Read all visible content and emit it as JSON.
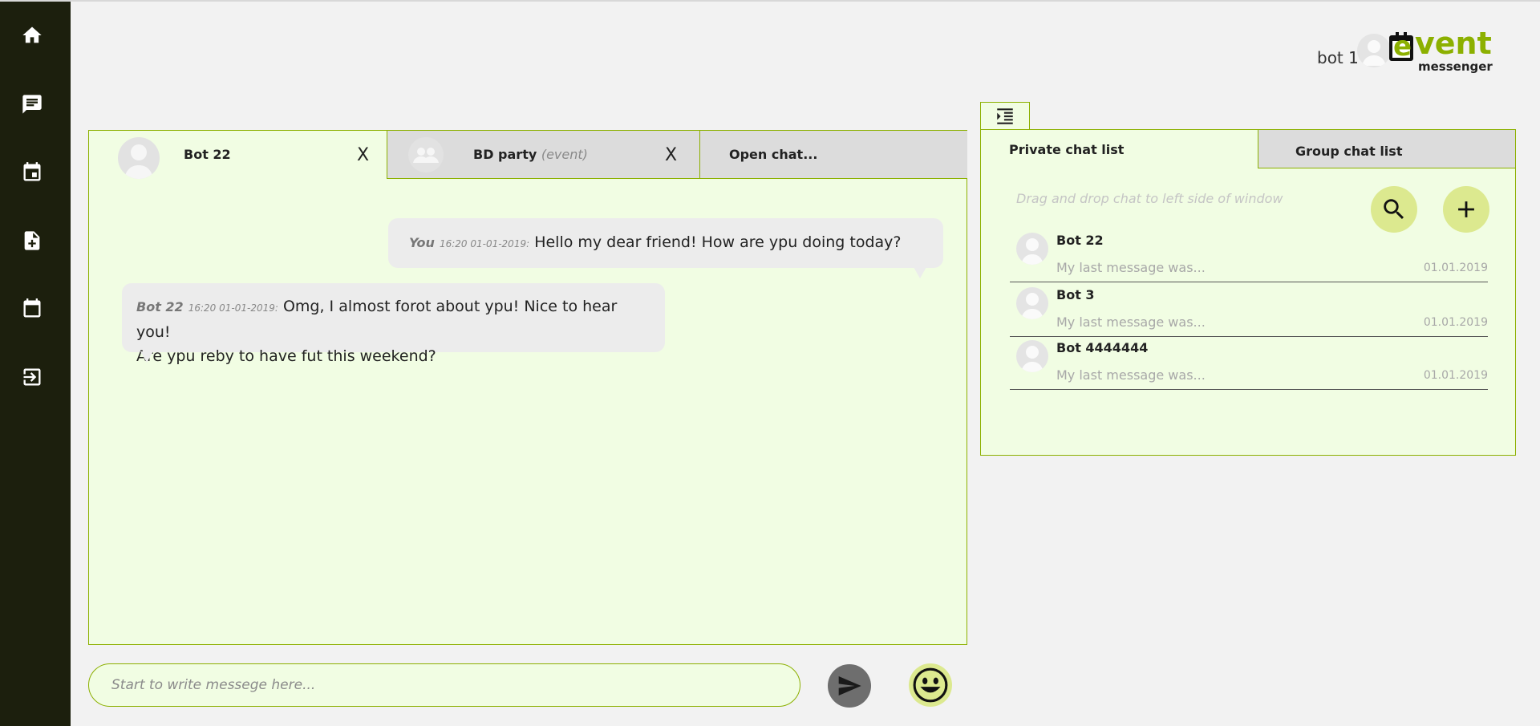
{
  "sidebar": {
    "items": [
      {
        "icon": "home-icon"
      },
      {
        "icon": "chat-icon"
      },
      {
        "icon": "event-icon"
      },
      {
        "icon": "add-document-icon"
      },
      {
        "icon": "calendar-icon"
      },
      {
        "icon": "logout-icon"
      }
    ]
  },
  "header": {
    "user_name": "bot 1",
    "logo_letter": "e",
    "logo_word": "vent",
    "logo_sub": "messenger"
  },
  "chat_tabs": [
    {
      "label": "Bot 22",
      "suffix": "",
      "close": "X"
    },
    {
      "label": "BD party",
      "suffix": "(event)",
      "close": "X"
    },
    {
      "label": "Open chat..."
    }
  ],
  "messages": [
    {
      "sender": "You",
      "time": "16:20 01-01-2019:",
      "text": "Hello my dear friend! How are ypu doing today?"
    },
    {
      "sender": "Bot 22",
      "time": "16:20 01-01-2019:",
      "text_line1": "Omg, I almost forot about ypu! Nice to hear you!",
      "text_line2": "Are ypu reby to have fut this weekend?"
    }
  ],
  "composer": {
    "placeholder": "Start to write messege here..."
  },
  "chat_list": {
    "tabs": {
      "private": "Private chat list",
      "group": "Group chat list"
    },
    "drag_hint": "Drag and drop chat to left side of window",
    "items": [
      {
        "name": "Bot 22",
        "last_message": "My last message was...",
        "date": "01.01.2019"
      },
      {
        "name": "Bot 3",
        "last_message": "My last message was...",
        "date": "01.01.2019"
      },
      {
        "name": "Bot 4444444",
        "last_message": "My last message was...",
        "date": "01.01.2019"
      }
    ]
  },
  "colors": {
    "accent": "#8cb000",
    "panel_bg": "#f1fde3",
    "sidebar_bg": "#1c1f0d",
    "button_bg": "#dce98f"
  }
}
